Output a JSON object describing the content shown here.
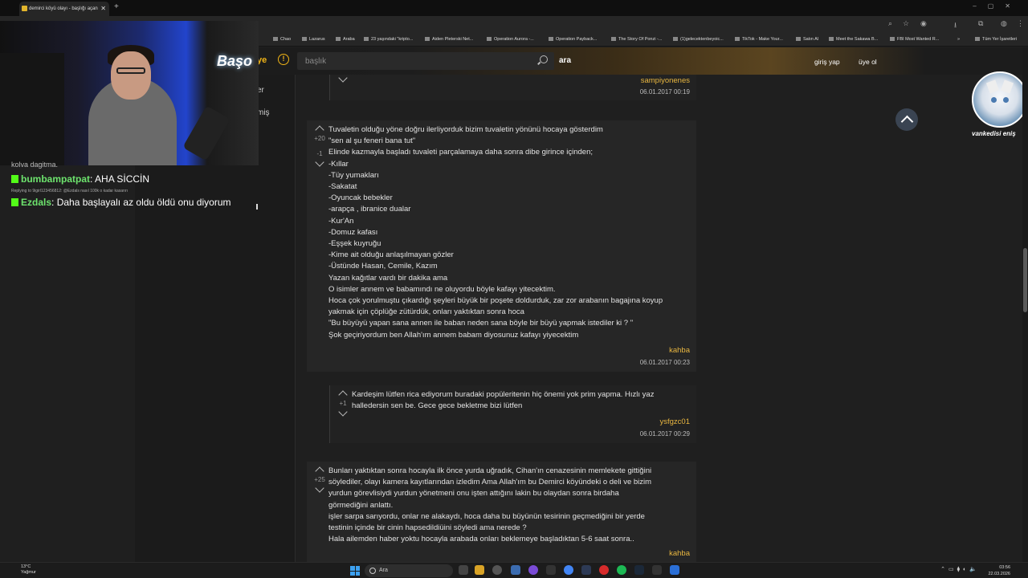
{
  "browser": {
    "tab_title": "demirci köyü olayı - başlığı açan",
    "bookmarks": [
      "Chao",
      "Lazarus",
      "Araba",
      "23 yaşındaki \"kripto...",
      "Aiden Pleterski Net...",
      "Operation Aurora -...",
      "Operation Payback...",
      "The Story Of Ponzi -...",
      "(1)gelecektenbeyoic...",
      "TikTok - Make Your...",
      "Satın Al",
      "Meet the Sakawa B...",
      "FBI Most Wanted R..."
    ],
    "bookmarks_right": "Tüm Yer İşaretleri"
  },
  "site": {
    "logo_fragment": "ye",
    "search_placeholder": "başlık",
    "search_button": "ara",
    "login": "giriş yap",
    "register": "üye ol",
    "left_items": [
      "er",
      "miş"
    ],
    "avatar_name": "vankedisi eniş"
  },
  "entries": [
    {
      "author": "sampiyonenes",
      "date": "06.01.2017 00:19"
    },
    {
      "votes_up": "+20",
      "votes_down": "-1",
      "lines": [
        "Tuvaletin olduğu yöne doğru ilerliyorduk bizim tuvaletin yönünü hocaya gösterdim",
        "\"sen al şu feneri bana tut\"",
        "Elinde kazmayla başladı tuvaleti parçalamaya daha sonra dibe girince içinden;",
        "-Kıllar",
        "-Tüy yumakları",
        "-Sakatat",
        "-Oyuncak bebekler",
        "-arapça , ibranice dualar",
        "-Kur'An",
        "-Domuz kafası",
        "-Eşşek kuyruğu",
        "-Kime ait olduğu anlaşılmayan gözler",
        "-Üstünde Hasan, Cemile, Kazım",
        "Yazan kağıtlar vardı bir dakika ama",
        "O isimler annem ve babamındı ne oluyordu böyle kafayı yitecektim.",
        "Hoca çok yorulmuştu çıkardığı şeyleri büyük bir poşete doldurduk, zar zor arabanın bagajına koyup",
        "yakmak için çöplüğe zütürdük, onları yaktıktan sonra hoca",
        "\"Bu büyüyü yapan sana annen ile baban neden sana böyle bir büyü yapmak istediler ki ? \"",
        "Şok geçiriyordum ben Allah'ım annem babam diyosunuz kafayı yiyecektim"
      ],
      "author": "kahba",
      "date": "06.01.2017 00:23"
    },
    {
      "votes": "+1",
      "lines": [
        "Kardeşim lütfen rica ediyorum buradaki popüleritenin hiç önemi yok prim yapma. Hızlı yaz",
        "halledersin sen be. Gece gece bekletme bizi lütfen"
      ],
      "author": "ysfgzc01",
      "date": "06.01.2017 00:29"
    },
    {
      "votes": "+25",
      "lines": [
        "Bunları yaktıktan sonra hocayla ilk önce yurda uğradık, Cihan'ın cenazesinin memlekete gittiğini",
        "söylediler, olayı kamera kayıtlarından izledim Ama Allah'ım bu Demirci köyündeki o deli ve bizim",
        "yurdun görevlisiydi yurdun yönetmeni onu işten attığını lakin bu olaydan sonra birdaha",
        "görmediğini anlattı.",
        "işler sarpa sarıyordu, onlar ne alakaydı, hoca daha bu büyünün tesirinin geçmediğini bir yerde",
        "testinin içinde bir cinin hapsedildiüini söyledi ama nerede ?",
        "Hala ailemden haber yoktu hocayla arabada onları beklemeye başladıktan 5-6 saat sonra.."
      ],
      "author": "kahba"
    }
  ],
  "stream": {
    "neon": "Başo",
    "chat": [
      {
        "user": "bumbampatpat",
        "text": "AHA SİCCİN"
      },
      {
        "user": "Ezdals",
        "text": "Daha başlayalı az oldu öldü onu diyorum"
      }
    ],
    "reply_note": "Replying to 9igirl123456812: @Ezdals nasıl 100k o kadar kasarırı",
    "cut_line": "kolva dagitma."
  },
  "taskbar": {
    "temp": "13°C",
    "weather": "Yağmur",
    "search": "Ara",
    "time": "03:56",
    "date": "22.03.2026"
  }
}
